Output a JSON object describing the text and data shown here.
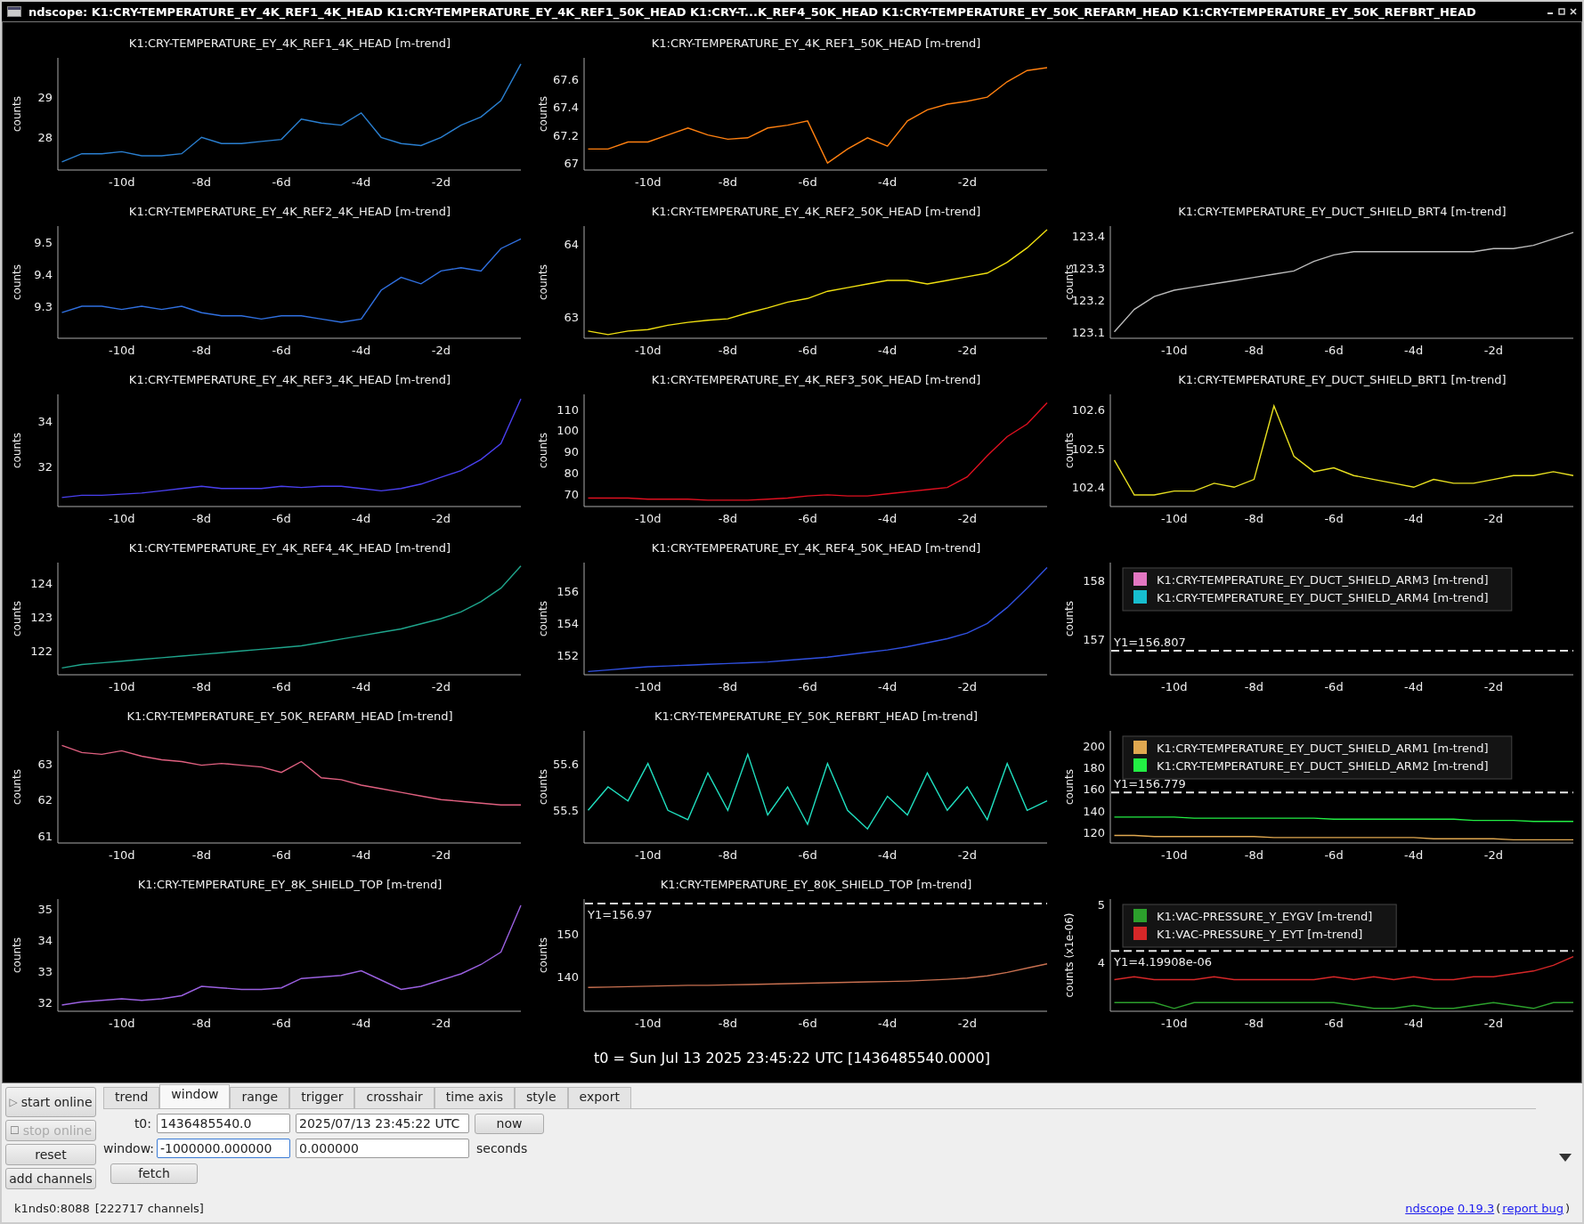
{
  "window": {
    "title": "ndscope: K1:CRY-TEMPERATURE_EY_4K_REF1_4K_HEAD K1:CRY-TEMPERATURE_EY_4K_REF1_50K_HEAD K1:CRY-T...K_REF4_50K_HEAD K1:CRY-TEMPERATURE_EY_50K_REFARM_HEAD K1:CRY-TEMPERATURE_EY_50K_REFBRT_HEAD"
  },
  "columns": [
    {
      "plots": [
        {
          "title": "K1:CRY-TEMPERATURE_EY_4K_REF1_4K_HEAD [m-trend]",
          "chart_data": {
            "type": "line",
            "ylabel": "counts",
            "x": [
              -11.5,
              -11,
              -10.5,
              -10,
              -9.5,
              -9,
              -8.5,
              -8,
              -7.5,
              -7,
              -6.5,
              -6,
              -5.5,
              -5,
              -4.5,
              -4,
              -3.5,
              -3,
              -2.5,
              -2,
              -1.5,
              -1,
              -0.5,
              0
            ],
            "xlim": [
              -11.6,
              0
            ],
            "ylim": [
              27.2,
              29.95
            ],
            "xticks": [
              {
                "value": -10,
                "label": "-10d"
              },
              {
                "value": -8,
                "label": "-8d"
              },
              {
                "value": -6,
                "label": "-6d"
              },
              {
                "value": -4,
                "label": "-4d"
              },
              {
                "value": -2,
                "label": "-2d"
              }
            ],
            "yticks": [
              28,
              29
            ],
            "series": [
              {
                "color": "#2a7fd0",
                "values": [
                  27.4,
                  27.6,
                  27.6,
                  27.65,
                  27.55,
                  27.55,
                  27.6,
                  28.0,
                  27.85,
                  27.85,
                  27.9,
                  27.95,
                  28.45,
                  28.35,
                  28.3,
                  28.6,
                  28.0,
                  27.85,
                  27.8,
                  28.0,
                  28.3,
                  28.5,
                  28.9,
                  29.8
                ]
              }
            ]
          }
        },
        {
          "title": "K1:CRY-TEMPERATURE_EY_4K_REF2_4K_HEAD [m-trend]",
          "chart_data": {
            "type": "line",
            "ylabel": "counts",
            "x": [
              -11.5,
              -11,
              -10.5,
              -10,
              -9.5,
              -9,
              -8.5,
              -8,
              -7.5,
              -7,
              -6.5,
              -6,
              -5.5,
              -5,
              -4.5,
              -4,
              -3.5,
              -3,
              -2.5,
              -2,
              -1.5,
              -1,
              -0.5,
              0
            ],
            "xlim": [
              -11.6,
              0
            ],
            "ylim": [
              9.2,
              9.55
            ],
            "xticks": [
              {
                "value": -10,
                "label": "-10d"
              },
              {
                "value": -8,
                "label": "-8d"
              },
              {
                "value": -6,
                "label": "-6d"
              },
              {
                "value": -4,
                "label": "-4d"
              },
              {
                "value": -2,
                "label": "-2d"
              }
            ],
            "yticks": [
              9.3,
              9.4,
              9.5
            ],
            "series": [
              {
                "color": "#3070e0",
                "values": [
                  9.28,
                  9.3,
                  9.3,
                  9.29,
                  9.3,
                  9.29,
                  9.3,
                  9.28,
                  9.27,
                  9.27,
                  9.26,
                  9.27,
                  9.27,
                  9.26,
                  9.25,
                  9.26,
                  9.35,
                  9.39,
                  9.37,
                  9.41,
                  9.42,
                  9.41,
                  9.48,
                  9.51
                ]
              }
            ]
          }
        },
        {
          "title": "K1:CRY-TEMPERATURE_EY_4K_REF3_4K_HEAD [m-trend]",
          "chart_data": {
            "type": "line",
            "ylabel": "counts",
            "x": [
              -11.5,
              -11,
              -10.5,
              -10,
              -9.5,
              -9,
              -8.5,
              -8,
              -7.5,
              -7,
              -6.5,
              -6,
              -5.5,
              -5,
              -4.5,
              -4,
              -3.5,
              -3,
              -2.5,
              -2,
              -1.5,
              -1,
              -0.5,
              0
            ],
            "xlim": [
              -11.6,
              0
            ],
            "ylim": [
              30.2,
              35.2
            ],
            "xticks": [
              {
                "value": -10,
                "label": "-10d"
              },
              {
                "value": -8,
                "label": "-8d"
              },
              {
                "value": -6,
                "label": "-6d"
              },
              {
                "value": -4,
                "label": "-4d"
              },
              {
                "value": -2,
                "label": "-2d"
              }
            ],
            "yticks": [
              32,
              34
            ],
            "series": [
              {
                "color": "#4a40f0",
                "values": [
                  30.6,
                  30.7,
                  30.7,
                  30.75,
                  30.8,
                  30.9,
                  31.0,
                  31.1,
                  31.0,
                  31.0,
                  31.0,
                  31.1,
                  31.05,
                  31.1,
                  31.1,
                  31.0,
                  30.9,
                  31.0,
                  31.2,
                  31.5,
                  31.8,
                  32.3,
                  33.0,
                  35.0
                ]
              }
            ]
          }
        },
        {
          "title": "K1:CRY-TEMPERATURE_EY_4K_REF4_4K_HEAD [m-trend]",
          "chart_data": {
            "type": "line",
            "ylabel": "counts",
            "x": [
              -11.5,
              -11,
              -10.5,
              -10,
              -9.5,
              -9,
              -8.5,
              -8,
              -7.5,
              -7,
              -6.5,
              -6,
              -5.5,
              -5,
              -4.5,
              -4,
              -3.5,
              -3,
              -2.5,
              -2,
              -1.5,
              -1,
              -0.5,
              0
            ],
            "xlim": [
              -11.6,
              0
            ],
            "ylim": [
              121.3,
              124.6
            ],
            "xticks": [
              {
                "value": -10,
                "label": "-10d"
              },
              {
                "value": -8,
                "label": "-8d"
              },
              {
                "value": -6,
                "label": "-6d"
              },
              {
                "value": -4,
                "label": "-4d"
              },
              {
                "value": -2,
                "label": "-2d"
              }
            ],
            "yticks": [
              122,
              123,
              124
            ],
            "series": [
              {
                "color": "#1fa58c",
                "values": [
                  121.5,
                  121.6,
                  121.65,
                  121.7,
                  121.75,
                  121.8,
                  121.85,
                  121.9,
                  121.95,
                  122.0,
                  122.05,
                  122.1,
                  122.15,
                  122.25,
                  122.35,
                  122.45,
                  122.55,
                  122.65,
                  122.8,
                  122.95,
                  123.15,
                  123.45,
                  123.85,
                  124.5
                ]
              }
            ]
          }
        },
        {
          "title": "K1:CRY-TEMPERATURE_EY_50K_REFARM_HEAD [m-trend]",
          "chart_data": {
            "type": "line",
            "ylabel": "counts",
            "x": [
              -11.5,
              -11,
              -10.5,
              -10,
              -9.5,
              -9,
              -8.5,
              -8,
              -7.5,
              -7,
              -6.5,
              -6,
              -5.5,
              -5,
              -4.5,
              -4,
              -3.5,
              -3,
              -2.5,
              -2,
              -1.5,
              -1,
              -0.5,
              0
            ],
            "xlim": [
              -11.6,
              0
            ],
            "ylim": [
              60.8,
              63.9
            ],
            "xticks": [
              {
                "value": -10,
                "label": "-10d"
              },
              {
                "value": -8,
                "label": "-8d"
              },
              {
                "value": -6,
                "label": "-6d"
              },
              {
                "value": -4,
                "label": "-4d"
              },
              {
                "value": -2,
                "label": "-2d"
              }
            ],
            "yticks": [
              61,
              62,
              63
            ],
            "series": [
              {
                "color": "#e06080",
                "values": [
                  63.5,
                  63.3,
                  63.25,
                  63.35,
                  63.2,
                  63.1,
                  63.05,
                  62.95,
                  63.0,
                  62.95,
                  62.9,
                  62.75,
                  63.05,
                  62.6,
                  62.55,
                  62.4,
                  62.3,
                  62.2,
                  62.1,
                  62.0,
                  61.95,
                  61.9,
                  61.85,
                  61.85
                ]
              }
            ]
          }
        },
        {
          "title": "K1:CRY-TEMPERATURE_EY_8K_SHIELD_TOP [m-trend]",
          "chart_data": {
            "type": "line",
            "ylabel": "counts",
            "x": [
              -11.5,
              -11,
              -10.5,
              -10,
              -9.5,
              -9,
              -8.5,
              -8,
              -7.5,
              -7,
              -6.5,
              -6,
              -5.5,
              -5,
              -4.5,
              -4,
              -3.5,
              -3,
              -2.5,
              -2,
              -1.5,
              -1,
              -0.5,
              0
            ],
            "xlim": [
              -11.6,
              0
            ],
            "ylim": [
              31.7,
              35.3
            ],
            "xticks": [
              {
                "value": -10,
                "label": "-10d"
              },
              {
                "value": -8,
                "label": "-8d"
              },
              {
                "value": -6,
                "label": "-6d"
              },
              {
                "value": -4,
                "label": "-4d"
              },
              {
                "value": -2,
                "label": "-2d"
              }
            ],
            "yticks": [
              32,
              33,
              34,
              35
            ],
            "series": [
              {
                "color": "#9a60e0",
                "values": [
                  31.9,
                  32.0,
                  32.05,
                  32.1,
                  32.05,
                  32.1,
                  32.2,
                  32.5,
                  32.45,
                  32.4,
                  32.4,
                  32.45,
                  32.75,
                  32.8,
                  32.85,
                  33.0,
                  32.7,
                  32.4,
                  32.5,
                  32.7,
                  32.9,
                  33.2,
                  33.6,
                  35.1
                ]
              }
            ]
          }
        }
      ]
    },
    {
      "plots": [
        {
          "title": "K1:CRY-TEMPERATURE_EY_4K_REF1_50K_HEAD [m-trend]",
          "chart_data": {
            "type": "line",
            "ylabel": "counts",
            "x": [
              -11.5,
              -11,
              -10.5,
              -10,
              -9.5,
              -9,
              -8.5,
              -8,
              -7.5,
              -7,
              -6.5,
              -6,
              -5.5,
              -5,
              -4.5,
              -4,
              -3.5,
              -3,
              -2.5,
              -2,
              -1.5,
              -1,
              -0.5,
              0
            ],
            "xlim": [
              -11.6,
              0
            ],
            "ylim": [
              66.95,
              67.75
            ],
            "xticks": [
              {
                "value": -10,
                "label": "-10d"
              },
              {
                "value": -8,
                "label": "-8d"
              },
              {
                "value": -6,
                "label": "-6d"
              },
              {
                "value": -4,
                "label": "-4d"
              },
              {
                "value": -2,
                "label": "-2d"
              }
            ],
            "yticks": [
              {
                "value": 67,
                "label": "67"
              },
              67.2,
              67.4,
              67.6
            ],
            "series": [
              {
                "color": "#ff8010",
                "values": [
                  67.1,
                  67.1,
                  67.15,
                  67.15,
                  67.2,
                  67.25,
                  67.2,
                  67.17,
                  67.18,
                  67.25,
                  67.27,
                  67.3,
                  67.0,
                  67.1,
                  67.18,
                  67.12,
                  67.3,
                  67.38,
                  67.42,
                  67.44,
                  67.47,
                  67.58,
                  67.66,
                  67.68
                ]
              }
            ]
          }
        },
        {
          "title": "K1:CRY-TEMPERATURE_EY_4K_REF2_50K_HEAD [m-trend]",
          "chart_data": {
            "type": "line",
            "ylabel": "counts",
            "x": [
              -11.5,
              -11,
              -10.5,
              -10,
              -9.5,
              -9,
              -8.5,
              -8,
              -7.5,
              -7,
              -6.5,
              -6,
              -5.5,
              -5,
              -4.5,
              -4,
              -3.5,
              -3,
              -2.5,
              -2,
              -1.5,
              -1,
              -0.5,
              0
            ],
            "xlim": [
              -11.6,
              0
            ],
            "ylim": [
              62.7,
              64.25
            ],
            "xticks": [
              {
                "value": -10,
                "label": "-10d"
              },
              {
                "value": -8,
                "label": "-8d"
              },
              {
                "value": -6,
                "label": "-6d"
              },
              {
                "value": -4,
                "label": "-4d"
              },
              {
                "value": -2,
                "label": "-2d"
              }
            ],
            "yticks": [
              63,
              64
            ],
            "series": [
              {
                "color": "#f0e010",
                "values": [
                  62.8,
                  62.75,
                  62.8,
                  62.82,
                  62.88,
                  62.92,
                  62.95,
                  62.97,
                  63.05,
                  63.12,
                  63.2,
                  63.25,
                  63.35,
                  63.4,
                  63.45,
                  63.5,
                  63.5,
                  63.45,
                  63.5,
                  63.55,
                  63.6,
                  63.75,
                  63.95,
                  64.2
                ]
              }
            ]
          }
        },
        {
          "title": "K1:CRY-TEMPERATURE_EY_4K_REF3_50K_HEAD [m-trend]",
          "chart_data": {
            "type": "line",
            "ylabel": "counts",
            "x": [
              -11.5,
              -11,
              -10.5,
              -10,
              -9.5,
              -9,
              -8.5,
              -8,
              -7.5,
              -7,
              -6.5,
              -6,
              -5.5,
              -5,
              -4.5,
              -4,
              -3.5,
              -3,
              -2.5,
              -2,
              -1.5,
              -1,
              -0.5,
              0
            ],
            "xlim": [
              -11.6,
              0
            ],
            "ylim": [
              64,
              117
            ],
            "xticks": [
              {
                "value": -10,
                "label": "-10d"
              },
              {
                "value": -8,
                "label": "-8d"
              },
              {
                "value": -6,
                "label": "-6d"
              },
              {
                "value": -4,
                "label": "-4d"
              },
              {
                "value": -2,
                "label": "-2d"
              }
            ],
            "yticks": [
              70,
              80,
              90,
              100,
              110
            ],
            "series": [
              {
                "color": "#e01020",
                "values": [
                  68,
                  68,
                  68,
                  67.5,
                  67.5,
                  67.5,
                  67,
                  67,
                  67,
                  67.5,
                  68,
                  69,
                  69.5,
                  69,
                  69,
                  70,
                  71,
                  72,
                  73,
                  78,
                  88,
                  97,
                  103,
                  113
                ]
              }
            ]
          }
        },
        {
          "title": "K1:CRY-TEMPERATURE_EY_4K_REF4_50K_HEAD [m-trend]",
          "chart_data": {
            "type": "line",
            "ylabel": "counts",
            "x": [
              -11.5,
              -11,
              -10.5,
              -10,
              -9.5,
              -9,
              -8.5,
              -8,
              -7.5,
              -7,
              -6.5,
              -6,
              -5.5,
              -5,
              -4.5,
              -4,
              -3.5,
              -3,
              -2.5,
              -2,
              -1.5,
              -1,
              -0.5,
              0
            ],
            "xlim": [
              -11.6,
              0
            ],
            "ylim": [
              150.8,
              157.8
            ],
            "xticks": [
              {
                "value": -10,
                "label": "-10d"
              },
              {
                "value": -8,
                "label": "-8d"
              },
              {
                "value": -6,
                "label": "-6d"
              },
              {
                "value": -4,
                "label": "-4d"
              },
              {
                "value": -2,
                "label": "-2d"
              }
            ],
            "yticks": [
              152,
              154,
              156
            ],
            "series": [
              {
                "color": "#3050e0",
                "values": [
                  151.0,
                  151.1,
                  151.2,
                  151.3,
                  151.35,
                  151.4,
                  151.45,
                  151.5,
                  151.55,
                  151.6,
                  151.7,
                  151.8,
                  151.9,
                  152.05,
                  152.2,
                  152.35,
                  152.55,
                  152.8,
                  153.05,
                  153.4,
                  154.0,
                  155.0,
                  156.2,
                  157.5
                ]
              }
            ]
          }
        },
        {
          "title": "K1:CRY-TEMPERATURE_EY_50K_REFBRT_HEAD [m-trend]",
          "chart_data": {
            "type": "line",
            "ylabel": "counts",
            "x": [
              -11.5,
              -11,
              -10.5,
              -10,
              -9.5,
              -9,
              -8.5,
              -8,
              -7.5,
              -7,
              -6.5,
              -6,
              -5.5,
              -5,
              -4.5,
              -4,
              -3.5,
              -3,
              -2.5,
              -2,
              -1.5,
              -1,
              -0.5,
              0
            ],
            "xlim": [
              -11.6,
              0
            ],
            "ylim": [
              55.43,
              55.67
            ],
            "xticks": [
              {
                "value": -10,
                "label": "-10d"
              },
              {
                "value": -8,
                "label": "-8d"
              },
              {
                "value": -6,
                "label": "-6d"
              },
              {
                "value": -4,
                "label": "-4d"
              },
              {
                "value": -2,
                "label": "-2d"
              }
            ],
            "yticks": [
              55.5,
              55.6
            ],
            "series": [
              {
                "color": "#20e0c0",
                "values": [
                  55.5,
                  55.55,
                  55.52,
                  55.6,
                  55.5,
                  55.48,
                  55.58,
                  55.5,
                  55.62,
                  55.49,
                  55.55,
                  55.47,
                  55.6,
                  55.5,
                  55.46,
                  55.53,
                  55.49,
                  55.58,
                  55.5,
                  55.55,
                  55.48,
                  55.6,
                  55.5,
                  55.52
                ]
              }
            ]
          }
        },
        {
          "title": "K1:CRY-TEMPERATURE_EY_80K_SHIELD_TOP [m-trend]",
          "chart_data": {
            "type": "line",
            "ylabel": "counts",
            "x": [
              -11.5,
              -11,
              -10.5,
              -10,
              -9.5,
              -9,
              -8.5,
              -8,
              -7.5,
              -7,
              -6.5,
              -6,
              -5.5,
              -5,
              -4.5,
              -4,
              -3.5,
              -3,
              -2.5,
              -2,
              -1.5,
              -1,
              -0.5,
              0
            ],
            "xlim": [
              -11.6,
              0
            ],
            "ylim": [
              132,
              158
            ],
            "xticks": [
              {
                "value": -10,
                "label": "-10d"
              },
              {
                "value": -8,
                "label": "-8d"
              },
              {
                "value": -6,
                "label": "-6d"
              },
              {
                "value": -4,
                "label": "-4d"
              },
              {
                "value": -2,
                "label": "-2d"
              }
            ],
            "yticks": [
              140,
              150
            ],
            "series": [
              {
                "color": "#c87050",
                "values": [
                  137.5,
                  137.6,
                  137.7,
                  137.8,
                  137.9,
                  138,
                  138,
                  138.1,
                  138.2,
                  138.3,
                  138.4,
                  138.5,
                  138.6,
                  138.7,
                  138.8,
                  138.9,
                  139,
                  139.2,
                  139.4,
                  139.7,
                  140.2,
                  141,
                  142,
                  143
                ]
              }
            ],
            "ref_lines": [
              {
                "axis": "y",
                "value": 156.97,
                "label": "Y1=156.97"
              }
            ]
          }
        }
      ]
    },
    {
      "plots": [
        {
          "title": "K1:CRY-TEMPERATURE_EY_DUCT_SHIELD_BRT4 [m-trend]",
          "chart_data": {
            "type": "line",
            "ylabel": "counts",
            "x": [
              -11.5,
              -11,
              -10.5,
              -10,
              -9.5,
              -9,
              -8.5,
              -8,
              -7.5,
              -7,
              -6.5,
              -6,
              -5.5,
              -5,
              -4.5,
              -4,
              -3.5,
              -3,
              -2.5,
              -2,
              -1.5,
              -1,
              -0.5,
              0
            ],
            "xlim": [
              -11.6,
              0
            ],
            "ylim": [
              123.08,
              123.43
            ],
            "xticks": [
              {
                "value": -10,
                "label": "-10d"
              },
              {
                "value": -8,
                "label": "-8d"
              },
              {
                "value": -6,
                "label": "-6d"
              },
              {
                "value": -4,
                "label": "-4d"
              },
              {
                "value": -2,
                "label": "-2d"
              }
            ],
            "yticks": [
              123.1,
              123.2,
              123.3,
              123.4
            ],
            "series": [
              {
                "color": "#bbbbbb",
                "values": [
                  123.1,
                  123.17,
                  123.21,
                  123.23,
                  123.24,
                  123.25,
                  123.26,
                  123.27,
                  123.28,
                  123.29,
                  123.32,
                  123.34,
                  123.35,
                  123.35,
                  123.35,
                  123.35,
                  123.35,
                  123.35,
                  123.35,
                  123.36,
                  123.36,
                  123.37,
                  123.39,
                  123.41
                ]
              }
            ]
          }
        },
        {
          "title": "K1:CRY-TEMPERATURE_EY_DUCT_SHIELD_BRT1 [m-trend]",
          "chart_data": {
            "type": "line",
            "ylabel": "counts",
            "x": [
              -11.5,
              -11,
              -10.5,
              -10,
              -9.5,
              -9,
              -8.5,
              -8,
              -7.5,
              -7,
              -6.5,
              -6,
              -5.5,
              -5,
              -4.5,
              -4,
              -3.5,
              -3,
              -2.5,
              -2,
              -1.5,
              -1,
              -0.5,
              0
            ],
            "xlim": [
              -11.6,
              0
            ],
            "ylim": [
              102.35,
              102.64
            ],
            "xticks": [
              {
                "value": -10,
                "label": "-10d"
              },
              {
                "value": -8,
                "label": "-8d"
              },
              {
                "value": -6,
                "label": "-6d"
              },
              {
                "value": -4,
                "label": "-4d"
              },
              {
                "value": -2,
                "label": "-2d"
              }
            ],
            "yticks": [
              102.4,
              102.5,
              102.6
            ],
            "series": [
              {
                "color": "#e8e020",
                "values": [
                  102.47,
                  102.38,
                  102.38,
                  102.39,
                  102.39,
                  102.41,
                  102.4,
                  102.42,
                  102.61,
                  102.48,
                  102.44,
                  102.45,
                  102.43,
                  102.42,
                  102.41,
                  102.4,
                  102.42,
                  102.41,
                  102.41,
                  102.42,
                  102.43,
                  102.43,
                  102.44,
                  102.43
                ]
              }
            ]
          }
        },
        {
          "time_axis": {
            "tick_labels": [
              "-10d",
              "-8d",
              "-6d",
              "-4d",
              "-2d"
            ]
          },
          "chart_data": {
            "type": "line",
            "ylabel": "counts",
            "legend": "upper left",
            "ylim": [
              156.4,
              158.3
            ],
            "yticks": [
              157,
              158
            ],
            "series": [
              {
                "name": "K1:CRY-TEMPERATURE_EY_DUCT_SHIELD_ARM3 [m-trend]",
                "color": "#e377c2"
              },
              {
                "name": "K1:CRY-TEMPERATURE_EY_DUCT_SHIELD_ARM4 [m-trend]",
                "color": "#17becf"
              }
            ],
            "ref_lines": [
              {
                "axis": "y",
                "value": 156.807,
                "label": "Y1=156.807"
              }
            ]
          }
        },
        {
          "chart_data": {
            "type": "line",
            "ylabel": "counts",
            "legend": "upper left",
            "x": [
              -11.5,
              -11,
              -10.5,
              -10,
              -9.5,
              -9,
              -8.5,
              -8,
              -7.5,
              -7,
              -6.5,
              -6,
              -5.5,
              -5,
              -4.5,
              -4,
              -3.5,
              -3,
              -2.5,
              -2,
              -1.5,
              -1,
              -0.5,
              0
            ],
            "xlim": [
              -11.6,
              0
            ],
            "ylim": [
              110,
              214
            ],
            "xticks": [
              {
                "value": -10,
                "label": "-10d"
              },
              {
                "value": -8,
                "label": "-8d"
              },
              {
                "value": -6,
                "label": "-6d"
              },
              {
                "value": -4,
                "label": "-4d"
              },
              {
                "value": -2,
                "label": "-2d"
              }
            ],
            "yticks": [
              120,
              140,
              160,
              180,
              200
            ],
            "series": [
              {
                "name": "K1:CRY-TEMPERATURE_EY_DUCT_SHIELD_ARM1 [m-trend]",
                "color": "#e0a850",
                "values": [
                  117,
                  117,
                  116,
                  116,
                  116,
                  116,
                  116,
                  116,
                  115,
                  115,
                  115,
                  115,
                  115,
                  115,
                  115,
                  115,
                  114,
                  114,
                  114,
                  114,
                  113,
                  113,
                  113,
                  113
                ]
              },
              {
                "name": "K1:CRY-TEMPERATURE_EY_DUCT_SHIELD_ARM2 [m-trend]",
                "color": "#22ee44",
                "values": [
                  134,
                  134,
                  134,
                  134,
                  133,
                  133,
                  133,
                  133,
                  133,
                  133,
                  133,
                  132,
                  132,
                  132,
                  132,
                  132,
                  132,
                  132,
                  131,
                  131,
                  131,
                  130,
                  130,
                  130
                ]
              }
            ],
            "ref_lines": [
              {
                "axis": "y",
                "value": 156.779,
                "label": "Y1=156.779"
              }
            ]
          }
        },
        {
          "chart_data": {
            "type": "line",
            "ylabel": "counts (x1e-06)",
            "legend": "upper left",
            "x": [
              -11.5,
              -11,
              -10.5,
              -10,
              -9.5,
              -9,
              -8.5,
              -8,
              -7.5,
              -7,
              -6.5,
              -6,
              -5.5,
              -5,
              -4.5,
              -4,
              -3.5,
              -3,
              -2.5,
              -2,
              -1.5,
              -1,
              -0.5,
              0
            ],
            "xlim": [
              -11.6,
              0
            ],
            "ylim": [
              3.15,
              5.1
            ],
            "xticks": [
              {
                "value": -10,
                "label": "-10d"
              },
              {
                "value": -8,
                "label": "-8d"
              },
              {
                "value": -6,
                "label": "-6d"
              },
              {
                "value": -4,
                "label": "-4d"
              },
              {
                "value": -2,
                "label": "-2d"
              }
            ],
            "yticks": [
              4,
              5
            ],
            "series": [
              {
                "name": "K1:VAC-PRESSURE_Y_EYGV [m-trend]",
                "color": "#2ca02c",
                "values": [
                  3.3,
                  3.3,
                  3.3,
                  3.2,
                  3.3,
                  3.3,
                  3.3,
                  3.3,
                  3.3,
                  3.3,
                  3.3,
                  3.3,
                  3.25,
                  3.2,
                  3.2,
                  3.25,
                  3.2,
                  3.2,
                  3.25,
                  3.3,
                  3.25,
                  3.2,
                  3.3,
                  3.3
                ]
              },
              {
                "name": "K1:VAC-PRESSURE_Y_EYT [m-trend]",
                "color": "#d62728",
                "values": [
                  3.7,
                  3.75,
                  3.7,
                  3.7,
                  3.7,
                  3.75,
                  3.7,
                  3.7,
                  3.7,
                  3.7,
                  3.7,
                  3.75,
                  3.7,
                  3.75,
                  3.7,
                  3.75,
                  3.7,
                  3.7,
                  3.75,
                  3.75,
                  3.8,
                  3.85,
                  3.95,
                  4.1
                ]
              }
            ],
            "ref_lines": [
              {
                "axis": "y",
                "value": 4.19908,
                "label": "Y1=4.19908e-06"
              }
            ]
          }
        }
      ]
    }
  ],
  "t0_line": "t0 = Sun Jul 13 2025 23:45:22 UTC [1436485540.0000]",
  "controls": {
    "side_buttons": [
      {
        "icon": "▷",
        "label": "start online",
        "disabled": false
      },
      {
        "icon": "☐",
        "label": "stop online",
        "disabled": true
      },
      {
        "label": "reset",
        "disabled": false
      },
      {
        "label": "add channels",
        "disabled": false
      }
    ],
    "tabs": [
      {
        "label": "trend",
        "selected": false
      },
      {
        "label": "window",
        "selected": true
      },
      {
        "label": "range",
        "selected": false
      },
      {
        "label": "trigger",
        "selected": false
      },
      {
        "label": "crosshair",
        "selected": false
      },
      {
        "label": "time axis",
        "selected": false
      },
      {
        "label": "style",
        "selected": false
      },
      {
        "label": "export",
        "selected": false
      }
    ],
    "t0": {
      "label": "t0:",
      "gps": "1436485540.0",
      "utc": "2025/07/13 23:45:22 UTC",
      "button": "now"
    },
    "window": {
      "label": "window:",
      "start": "-1000000.000000",
      "end": "0.000000",
      "unit": "seconds"
    },
    "fetch_button": "fetch"
  },
  "status_bar": {
    "server": "k1nds0:8088",
    "channels": "[222717 channels]",
    "footer": [
      {
        "kind": "link",
        "text": "ndscope"
      },
      {
        "kind": "link",
        "text": "0.19.3"
      },
      {
        "kind": "text",
        "text": "("
      },
      {
        "kind": "link",
        "text": "report bug"
      },
      {
        "kind": "text",
        "text": ")"
      }
    ]
  }
}
